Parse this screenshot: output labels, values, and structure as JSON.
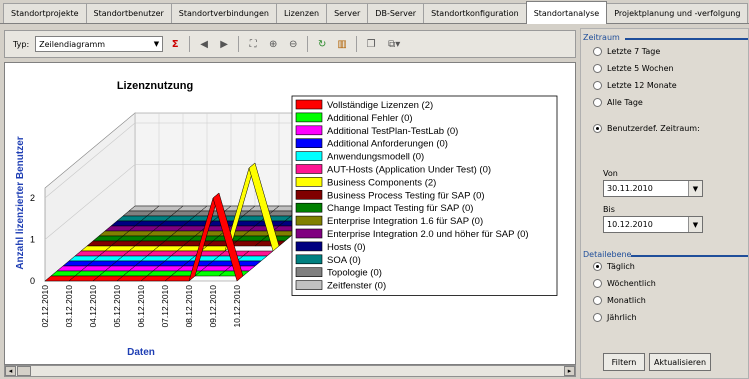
{
  "tabs": [
    "Standortprojekte",
    "Standortbenutzer",
    "Standortverbindungen",
    "Lizenzen",
    "Server",
    "DB-Server",
    "Standortkonfiguration",
    "Standortanalyse",
    "Projektplanung und -verfolgung"
  ],
  "active_tab": "Standortanalyse",
  "toolbar": {
    "type_label": "Typ:",
    "type_value": "Zeilendiagramm"
  },
  "chart_data": {
    "type": "line",
    "title": "Lizenznutzung",
    "xlabel": "Daten",
    "ylabel": "Anzahl lizenzierter Benutzer",
    "ylim": [
      0,
      2
    ],
    "yticks": [
      "0",
      "1",
      "2"
    ],
    "categories": [
      "02.12.2010",
      "03.12.2010",
      "04.12.2010",
      "05.12.2010",
      "06.12.2010",
      "07.12.2010",
      "08.12.2010",
      "09.12.2010",
      "10.12.2010"
    ],
    "series": [
      {
        "name": "Vollständige Lizenzen (2)",
        "color": "#ff0000",
        "values": [
          0,
          0,
          0,
          0,
          0,
          0,
          0,
          2,
          0
        ]
      },
      {
        "name": "Additional Fehler (0)",
        "color": "#00ff00",
        "values": [
          0,
          0,
          0,
          0,
          0,
          0,
          0,
          0,
          0
        ]
      },
      {
        "name": "Additional TestPlan-TestLab (0)",
        "color": "#ff00ff",
        "values": [
          0,
          0,
          0,
          0,
          0,
          0,
          0,
          0,
          0
        ]
      },
      {
        "name": "Additional Anforderungen (0)",
        "color": "#0000ff",
        "values": [
          0,
          0,
          0,
          0,
          0,
          0,
          0,
          0,
          0
        ]
      },
      {
        "name": "Anwendungsmodell (0)",
        "color": "#00ffff",
        "values": [
          0,
          0,
          0,
          0,
          0,
          0,
          0,
          0,
          0
        ]
      },
      {
        "name": "AUT-Hosts (Application Under Test) (0)",
        "color": "#ff1493",
        "values": [
          0,
          0,
          0,
          0,
          0,
          0,
          0,
          0,
          0
        ]
      },
      {
        "name": "Business Components (2)",
        "color": "#ffff00",
        "values": [
          0,
          0,
          0,
          0,
          0,
          0,
          0,
          2,
          0
        ]
      },
      {
        "name": "Business Process Testing für SAP (0)",
        "color": "#800000",
        "values": [
          0,
          0,
          0,
          0,
          0,
          0,
          0,
          0,
          0
        ]
      },
      {
        "name": "Change Impact Testing für SAP (0)",
        "color": "#008000",
        "values": [
          0,
          0,
          0,
          0,
          0,
          0,
          0,
          0,
          0
        ]
      },
      {
        "name": "Enterprise Integration 1.6 für SAP (0)",
        "color": "#808000",
        "values": [
          0,
          0,
          0,
          0,
          0,
          0,
          0,
          0,
          0
        ]
      },
      {
        "name": "Enterprise Integration 2.0 und höher für SAP (0)",
        "color": "#800080",
        "values": [
          0,
          0,
          0,
          0,
          0,
          0,
          0,
          0,
          0
        ]
      },
      {
        "name": "Hosts (0)",
        "color": "#000080",
        "values": [
          0,
          0,
          0,
          0,
          0,
          0,
          0,
          0,
          0
        ]
      },
      {
        "name": "SOA (0)",
        "color": "#008080",
        "values": [
          0,
          0,
          0,
          0,
          0,
          0,
          0,
          0,
          0
        ]
      },
      {
        "name": "Topologie (0)",
        "color": "#808080",
        "values": [
          0,
          0,
          0,
          0,
          0,
          0,
          0,
          0,
          0
        ]
      },
      {
        "name": "Zeitfenster (0)",
        "color": "#c0c0c0",
        "values": [
          0,
          0,
          0,
          0,
          0,
          0,
          0,
          0,
          0
        ]
      }
    ]
  },
  "panel": {
    "zeitraum_label": "Zeitraum",
    "zeitraum_options": [
      "Letzte 7 Tage",
      "Letzte 5 Wochen",
      "Letzte 12 Monate",
      "Alle Tage",
      "Benutzerdef. Zeitraum:"
    ],
    "zeitraum_selected": "Benutzerdef. Zeitraum:",
    "von_label": "Von",
    "von_value": "30.11.2010",
    "bis_label": "Bis",
    "bis_value": "10.12.2010",
    "detail_label": "Detailebene",
    "detail_options": [
      "Täglich",
      "Wöchentlich",
      "Monatlich",
      "Jährlich"
    ],
    "detail_selected": "Täglich",
    "filter_button": "Filtern",
    "refresh_button": "Aktualisieren"
  }
}
